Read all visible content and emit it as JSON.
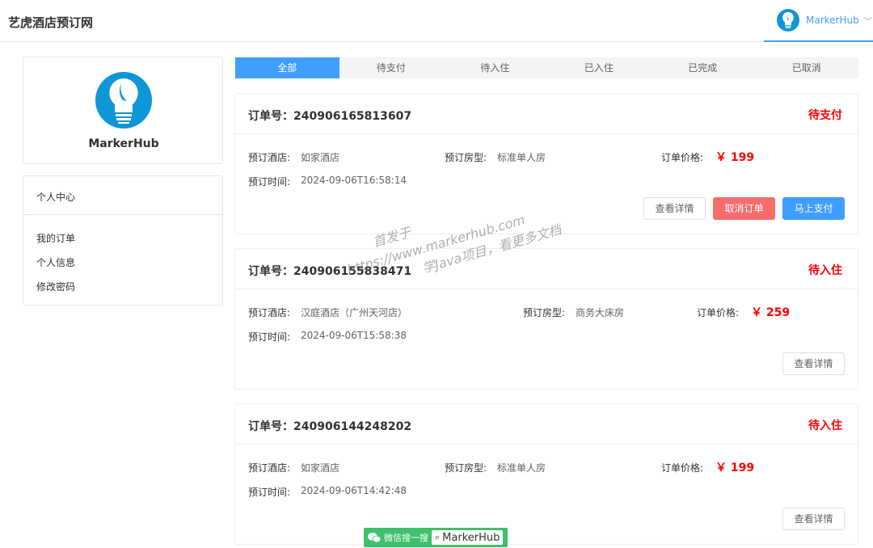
{
  "header": {
    "site_title": "艺虎酒店预订网",
    "username": "MarkerHub"
  },
  "profile": {
    "name": "MarkerHub"
  },
  "menu": {
    "title": "个人中心",
    "items": [
      {
        "label": "我的订单"
      },
      {
        "label": "个人信息"
      },
      {
        "label": "修改密码"
      }
    ]
  },
  "tabs": [
    {
      "label": "全部",
      "active": true
    },
    {
      "label": "待支付"
    },
    {
      "label": "待入住"
    },
    {
      "label": "已入住"
    },
    {
      "label": "已完成"
    },
    {
      "label": "已取消"
    }
  ],
  "labels": {
    "order_no_prefix": "订单号：",
    "hotel": "预订酒店:",
    "room_type": "预订房型:",
    "price": "订单价格:",
    "time": "预订时间:"
  },
  "buttons": {
    "detail": "查看详情",
    "cancel": "取消订单",
    "pay": "马上支付"
  },
  "orders": [
    {
      "order_no": "240906165813607",
      "status": "待支付",
      "hotel": "如家酒店",
      "room_type": "标准单人房",
      "price": "￥ 199",
      "time": "2024-09-06T16:58:14"
    },
    {
      "order_no": "240906155838471",
      "status": "待入住",
      "hotel": "汉庭酒店（广州天河店）",
      "room_type": "商务大床房",
      "price": "￥ 259",
      "time": "2024-09-06T15:58:38"
    },
    {
      "order_no": "240906144248202",
      "status": "待入住",
      "hotel": "如家酒店",
      "room_type": "标准单人房",
      "price": "￥ 199",
      "time": "2024-09-06T14:42:48"
    }
  ],
  "watermark": {
    "line1": "首发于",
    "line2": "https://www.markerhub.com",
    "line3": "学Java项目，看更多文档"
  },
  "footer_badge": {
    "text": "微信搜一搜",
    "search": "MarkerHub"
  },
  "colors": {
    "primary": "#409eff",
    "danger": "#f56c6c",
    "status": "#ff0000",
    "logo": "#0f96d6"
  }
}
